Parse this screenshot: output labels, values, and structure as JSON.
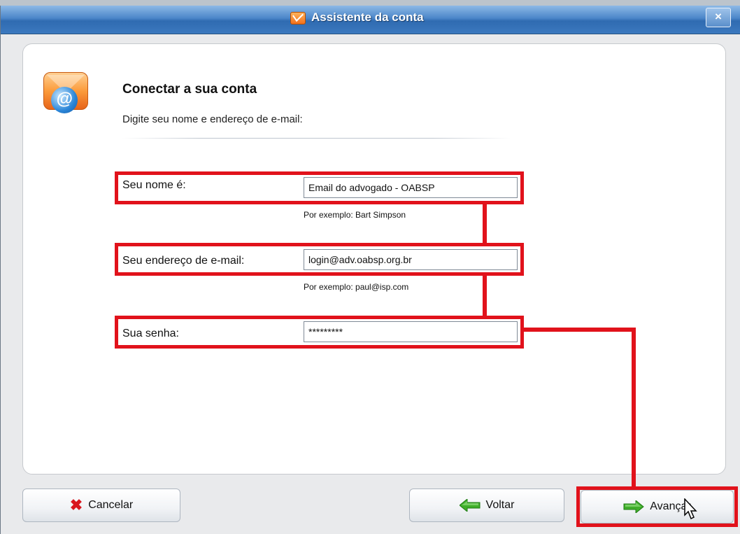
{
  "window": {
    "title": "Assistente da conta",
    "close_label": "×"
  },
  "header": {
    "title": "Conectar a sua conta",
    "subtitle": "Digite seu nome e endereço de e-mail:"
  },
  "form": {
    "name": {
      "label": "Seu nome é:",
      "value": "Email do advogado - OABSP",
      "hint": "Por exemplo: Bart Simpson"
    },
    "email": {
      "label": "Seu endereço de e-mail:",
      "value": "login@adv.oabsp.org.br",
      "hint": "Por exemplo: paul@isp.com"
    },
    "password": {
      "label": "Sua senha:",
      "value": "*********"
    }
  },
  "buttons": {
    "cancel": "Cancelar",
    "back": "Voltar",
    "next": "Avançar"
  },
  "icons": {
    "title": "envelope-icon",
    "header": "mail-at-icon",
    "cancel": "red-x-icon",
    "back": "green-left-arrow-icon",
    "next": "green-right-arrow-icon"
  },
  "colors": {
    "annotation_red": "#e1121b",
    "titlebar_blue": "#3c79bf",
    "arrow_green": "#3fae2a"
  }
}
